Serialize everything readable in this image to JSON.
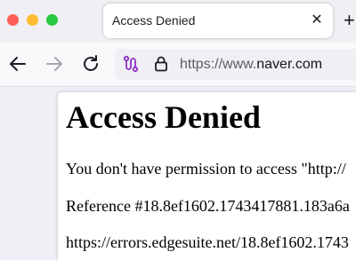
{
  "browser": {
    "tab": {
      "title": "Access Denied",
      "close_glyph": "✕"
    },
    "new_tab_glyph": "+",
    "icons": {
      "back": "arrow-left-icon",
      "forward": "arrow-right-icon",
      "reload": "reload-icon",
      "extension": "extension-icon",
      "lock": "lock-icon"
    },
    "address_bar": {
      "prefix": "https://www.",
      "host": "naver.com"
    },
    "colors": {
      "close": "#ff5f57",
      "minimize": "#febc2e",
      "maximize": "#28c840",
      "extension": "#8f2fc7"
    }
  },
  "page": {
    "heading": "Access Denied",
    "message": "You don't have permission to access \"http://",
    "reference": "Reference #18.8ef1602.1743417881.183a6a",
    "error_url": "https://errors.edgesuite.net/18.8ef1602.1743"
  }
}
